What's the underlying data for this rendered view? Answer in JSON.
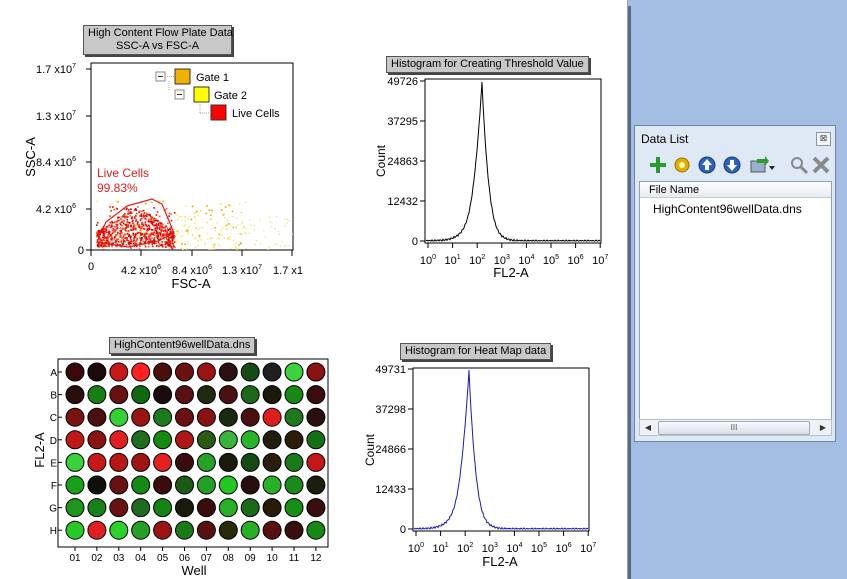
{
  "scatter": {
    "title_line1": "High Content Flow Plate Data",
    "title_line2": "SSC-A vs FSC-A",
    "y_label": "SSC-A",
    "x_label": "FSC-A",
    "y_ticks": [
      "1.7 x10",
      "1.3 x10",
      "8.4 x10",
      "4.2 x10",
      "0"
    ],
    "y_tick_exps": [
      "7",
      "7",
      "6",
      "6",
      ""
    ],
    "x_ticks": [
      "0",
      "4.2 x10",
      "8.4 x10",
      "1.3 x10",
      "1.7 x1"
    ],
    "x_tick_exps": [
      "",
      "6",
      "6",
      "7",
      ""
    ],
    "gate_tree": [
      "Gate 1",
      "Gate 2",
      "Live Cells"
    ],
    "gate_colors": [
      "#f2b000",
      "#ffff00",
      "#ff0000"
    ],
    "gate_label": "Live Cells",
    "gate_percent": "99.83%"
  },
  "hist1": {
    "title": "Histogram for Creating Threshold Value",
    "y_label": "Count",
    "x_label": "FL2-A",
    "y_ticks": [
      "49726",
      "37295",
      "24863",
      "12432",
      "0"
    ],
    "x_exps": [
      "0",
      "1",
      "2",
      "3",
      "4",
      "5",
      "6",
      "7"
    ],
    "color": "#000000"
  },
  "hist2": {
    "title": "Histogram for Heat Map data",
    "y_label": "Count",
    "x_label": "FL2-A",
    "y_ticks": [
      "49731",
      "37298",
      "24866",
      "12433",
      "0"
    ],
    "x_exps": [
      "0",
      "1",
      "2",
      "3",
      "4",
      "5",
      "6",
      "7"
    ],
    "color": "#1a1ab5"
  },
  "heatmap": {
    "title": "HighContent96wellData.dns",
    "y_label": "FL2-A",
    "x_label": "Well",
    "rows": [
      "A",
      "B",
      "C",
      "D",
      "E",
      "F",
      "G",
      "H"
    ],
    "cols": [
      "01",
      "02",
      "03",
      "04",
      "05",
      "06",
      "07",
      "08",
      "09",
      "10",
      "11",
      "12"
    ],
    "wells": [
      [
        "#3a0a0a",
        "#1a0a0a",
        "#c81818",
        "#ff2020",
        "#4a0e0e",
        "#6b1010",
        "#9a1414",
        "#2a1010",
        "#144a14",
        "#1f1f1f",
        "#3cd23c",
        "#8a1212"
      ],
      [
        "#2a0e0e",
        "#148014",
        "#6a1010",
        "#0f6a0f",
        "#1a0c0c",
        "#5a1010",
        "#1f2a0e",
        "#4a0f0f",
        "#1a6a1a",
        "#1a1a0a",
        "#148a14",
        "#3a0e0e"
      ],
      [
        "#7a1212",
        "#4a0f0f",
        "#32d232",
        "#9a1414",
        "#1e7a1e",
        "#6a1010",
        "#8a1212",
        "#1a2a0e",
        "#4a0f0f",
        "#e01c1c",
        "#1e781e",
        "#2a0f0f"
      ],
      [
        "#c01818",
        "#8a1212",
        "#e02020",
        "#1e6e1e",
        "#148a14",
        "#b01616",
        "#2a5a14",
        "#3ab43a",
        "#2ab42a",
        "#1e1e0a",
        "#2a1e0a",
        "#147014"
      ],
      [
        "#3ad23a",
        "#c81818",
        "#b81616",
        "#a01414",
        "#e42020",
        "#3a0c0c",
        "#26a026",
        "#1a1a0a",
        "#144a14",
        "#2a1e0a",
        "#1a7a1a",
        "#c41818"
      ],
      [
        "#18a018",
        "#0f0f0a",
        "#6a1010",
        "#148a14",
        "#3a0c0c",
        "#1a5a14",
        "#24a024",
        "#22c822",
        "#2a0e0e",
        "#28b028",
        "#1a8a1a",
        "#1a1e0a"
      ],
      [
        "#1e961e",
        "#188018",
        "#6a1010",
        "#1e6a1e",
        "#148214",
        "#1a1a0a",
        "#3a0c0c",
        "#28b028",
        "#1a6a1a",
        "#2a1a0a",
        "#149014",
        "#3a0e0e"
      ],
      [
        "#28c828",
        "#e02020",
        "#2ad22a",
        "#24a024",
        "#9a1414",
        "#1a7a1a",
        "#5a1010",
        "#2a2a0a",
        "#26b026",
        "#5a1010",
        "#3a0e0e",
        "#148a14"
      ]
    ]
  },
  "data_list": {
    "title": "Data List",
    "column_header": "File Name",
    "files": [
      "HighContent96wellData.dns"
    ],
    "toolbar_icons": [
      "add-icon",
      "settings-icon",
      "move-up-icon",
      "move-down-icon",
      "export-icon",
      "dropdown-icon",
      "search-icon",
      "delete-icon"
    ],
    "close_glyph": "⊠",
    "scroll_thumb_glyph": "III"
  }
}
